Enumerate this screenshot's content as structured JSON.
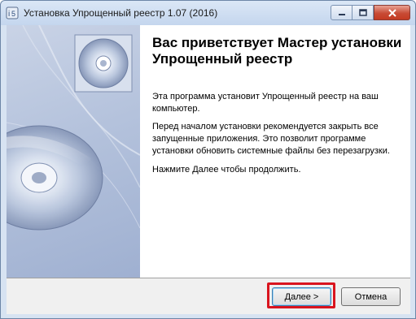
{
  "window": {
    "title": "Установка Упрощенный реестр 1.07 (2016)",
    "icon": "setup-app-icon",
    "controls": {
      "minimize": "minimize-icon",
      "maximize": "maximize-icon",
      "close": "close-icon"
    }
  },
  "wizard": {
    "heading": "Вас приветствует Мастер установки Упрощенный реестр",
    "paragraph1": "Эта программа установит Упрощенный реестр на ваш компьютер.",
    "paragraph2": "Перед началом установки рекомендуется закрыть все запущенные приложения. Это позволит программе установки обновить системные файлы без перезагрузки.",
    "paragraph3": "Нажмите Далее чтобы продолжить.",
    "image": "setup-disc-banner"
  },
  "buttons": {
    "next_label": "Далее >",
    "cancel_label": "Отмена"
  },
  "colors": {
    "highlight": "#d9141e",
    "banner": "#b4c2dc"
  }
}
